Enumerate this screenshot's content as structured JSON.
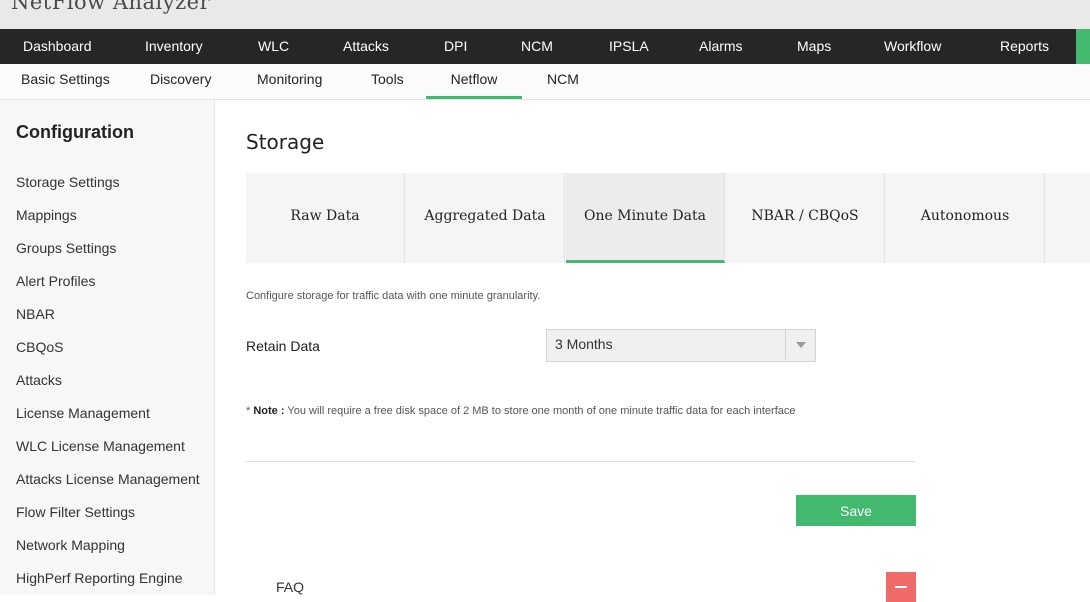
{
  "app": {
    "title": "NetFlow Analyzer"
  },
  "main_nav": [
    "Dashboard",
    "Inventory",
    "WLC",
    "Attacks",
    "DPI",
    "NCM",
    "IPSLA",
    "Alarms",
    "Maps",
    "Workflow",
    "Reports"
  ],
  "sub_nav": {
    "items": [
      "Basic Settings",
      "Discovery",
      "Monitoring",
      "Tools",
      "Netflow",
      "NCM"
    ],
    "active": "Netflow"
  },
  "sidebar": {
    "heading": "Configuration",
    "items": [
      "Storage Settings",
      "Mappings",
      "Groups Settings",
      "Alert Profiles",
      "NBAR",
      "CBQoS",
      "Attacks",
      "License Management",
      "WLC License Management",
      "Attacks License Management",
      "Flow Filter Settings",
      "Network Mapping",
      "HighPerf Reporting Engine"
    ]
  },
  "page": {
    "title": "Storage",
    "tabs": [
      "Raw Data",
      "Aggregated Data",
      "One Minute Data",
      "NBAR / CBQoS",
      "Autonomous"
    ],
    "active_tab": "One Minute Data",
    "description": "Configure storage for traffic data with one minute granularity.",
    "retain_label": "Retain Data",
    "retain_value": "3 Months",
    "note_marker": "*",
    "note_label": "Note :",
    "note_text": "You will require a free disk space of 2 MB to store one month of one minute traffic data for each interface",
    "save_label": "Save",
    "faq_label": "FAQ",
    "faq_toggle": "—"
  },
  "colors": {
    "accent": "#43b96f",
    "nav_bg": "#262626",
    "faq_toggle": "#f06a6a"
  }
}
